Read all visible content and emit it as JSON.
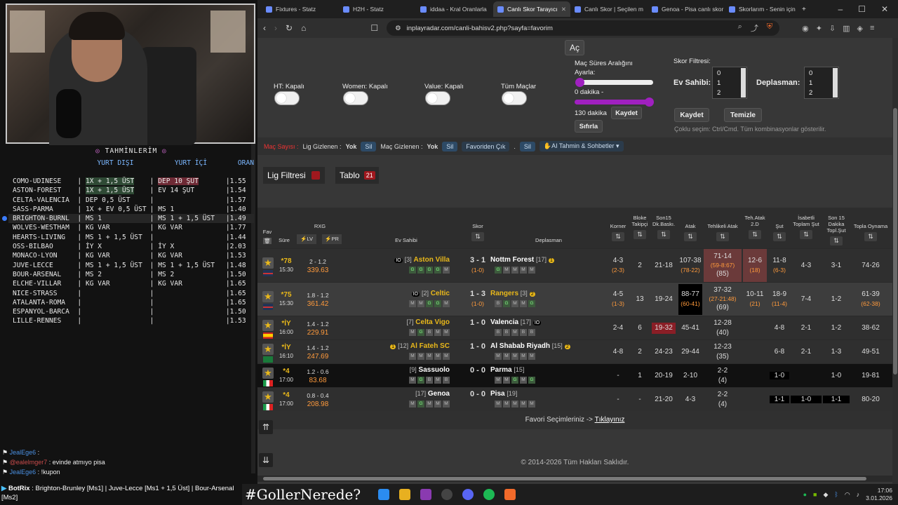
{
  "stream": {
    "tips_title": "TAHMİNLERİM",
    "col_away": "YURT DIŞI",
    "col_home": "YURT İÇİ",
    "col_odds": "ORAN",
    "tips": [
      {
        "match": "COMO-UDINESE",
        "a": "1X + 1,5 ÜST",
        "b": "DEP 10 ŞUT",
        "odd": "1.55",
        "hl": "red"
      },
      {
        "match": "ASTON-FOREST",
        "a": "1X + 1,5 ÜST",
        "b": "EV 14 ŞUT",
        "odd": "1.54",
        "hl": "grn"
      },
      {
        "match": "CELTA-VALENCIA",
        "a": "DEP 0,5 ÜST",
        "b": "",
        "odd": "1.57",
        "hl": ""
      },
      {
        "match": "SASS-PARMA",
        "a": "1X + EV 0,5 ÜST",
        "b": "MS 1",
        "odd": "1.40",
        "hl": ""
      },
      {
        "match": "BRIGHTON-BURNL",
        "a": "MS 1",
        "b": "MS 1 + 1,5 ÜST",
        "odd": "1.49",
        "hl": "sel"
      },
      {
        "match": "WOLVES-WESTHAM",
        "a": "KG VAR",
        "b": "KG VAR",
        "odd": "1.77",
        "hl": ""
      },
      {
        "match": "HEARTS-LIVING",
        "a": "MS 1 + 1,5 ÜST",
        "b": "",
        "odd": "1.44",
        "hl": ""
      },
      {
        "match": "OSS-BILBAO",
        "a": "İY X",
        "b": "İY X",
        "odd": "2.03",
        "hl": ""
      },
      {
        "match": "MONACO-LYON",
        "a": "KG VAR",
        "b": "KG VAR",
        "odd": "1.53",
        "hl": ""
      },
      {
        "match": "JUVE-LECCE",
        "a": "MS 1 + 1,5 ÜST",
        "b": "MS 1 + 1,5 ÜST",
        "odd": "1.48",
        "hl": ""
      },
      {
        "match": "BOUR-ARSENAL",
        "a": "MS 2",
        "b": "MS 2",
        "odd": "1.50",
        "hl": ""
      },
      {
        "match": "ELCHE-VILLAR",
        "a": "KG VAR",
        "b": "KG VAR",
        "odd": "1.65",
        "hl": ""
      },
      {
        "match": "NICE-STRASS",
        "a": "",
        "b": "",
        "odd": "1.65",
        "hl": ""
      },
      {
        "match": "ATALANTA-ROMA",
        "a": "",
        "b": "",
        "odd": "1.65",
        "hl": ""
      },
      {
        "match": "ESPANYOL-BARCA",
        "a": "",
        "b": "",
        "odd": "1.50",
        "hl": ""
      },
      {
        "match": "LILLE-RENNES",
        "a": "",
        "b": "",
        "odd": "1.53",
        "hl": ""
      }
    ],
    "chat": [
      {
        "user": "JealEge6",
        "text": ""
      },
      {
        "user": "@ealelmger7",
        "text": "evinde atmıyo pisa"
      },
      {
        "user": "JealEge6",
        "text": "!kupon"
      }
    ],
    "bot_user": "BotRix",
    "bot_text": ": Brighton-Brunley [Ms1] | Juve-Lecce [Ms1 + 1,5 Üst] | Bour-Arsenal [Ms2]",
    "hashtag": "#GollerNerede?"
  },
  "browser": {
    "tabs": [
      "Fixtures - Statz",
      "H2H - Statz",
      "iddaa - Kral Oranlarla",
      "Canlı Skor Tarayıcı",
      "Canlı Skor | Seçilen m",
      "Genoa - Pisa canlı skor",
      "Skorlarım - Senin için"
    ],
    "url": "inplayradar.com/canli-bahisv2.php?sayfa=favorim"
  },
  "filters": {
    "open_btn": "Aç",
    "ht": "HT: Kapalı",
    "women": "Women: Kapalı",
    "value": "Value: Kapalı",
    "all": "Tüm Maçlar",
    "range_title": "Maç Süres Aralığını Ayarla:",
    "range_min": "0 dakika -",
    "range_max": "130 dakika",
    "save": "Kaydet",
    "reset": "Sıfırla",
    "score_title": "Skor Filtresi:",
    "home_label": "Ev Sahibi:",
    "away_label": "Deplasman:",
    "score_opts": [
      "0",
      "1",
      "2"
    ],
    "save2": "Kaydet",
    "clear": "Temizle",
    "hint": "Çoklu seçim: Ctrl/Cmd. Tüm kombinasyonlar gösterilir."
  },
  "chips": {
    "count_label": "Maç Sayısı :",
    "lig_hidden": "Lig Gizlenen :",
    "yok": "Yok",
    "sil": "Sil",
    "mac_hidden": "Maç Gizlenen :",
    "unfav": "Favoriden Çık",
    "ai": "AI Tahmin & Sohbetler"
  },
  "lig_filter": "Lig Filtresi",
  "tablo": "Tablo",
  "tablo_count": "21",
  "headers": {
    "fav": "Fav",
    "sure": "Süre",
    "rxg": "RXG",
    "lv": "LV",
    "pr": "PR",
    "home": "Ev Sahibi",
    "score": "Skor",
    "away": "Deplasman",
    "korner": "Korner",
    "bloke": "Bloke Takipçi",
    "son15": "Son15 Dk.Baskı.",
    "atak": "Atak",
    "tatak": "Tehlikeli Atak",
    "teh2d": "Teh.Atak 2.D",
    "sut": "Şut",
    "isabet": "İsabetli Toplam Şut",
    "son15sut": "Son 15 Dakika Topl.Şut",
    "topla": "Topla Oynama"
  },
  "matches": [
    {
      "min": "78",
      "time": "15:30",
      "xg": "2 - 1.2",
      "rx": "339.63",
      "home": "Aston Villa",
      "hrank": "[3]",
      "hbadge": "IO",
      "score": "3 - 1",
      "ht": "(1-0)",
      "away": "Nottm Forest",
      "arank": "[17]",
      "abadge": "1",
      "korner": "4-3",
      "ksub": "(2-3)",
      "bloke": "2",
      "son15": "21-18",
      "atak": "107-38",
      "asub": "(78-22)",
      "tatak": "71-14",
      "tsub": "(59-8:67)",
      "tsub2": "(85)",
      "t2d": "12-6",
      "t2dsub": "(18)",
      "sut": "11-8",
      "ssub": "(6-3)",
      "isabet": "4-3",
      "s15": "3-1",
      "topla": "74-26",
      "tsub3": ""
    },
    {
      "min": "75",
      "time": "15:30",
      "xg": "1.8 - 1.2",
      "rx": "361.42",
      "home": "Celtic",
      "hrank": "[2]",
      "hbadge": "IO",
      "score": "1 - 3",
      "ht": "(1-0)",
      "away": "Rangers",
      "arank": "[3]",
      "abadge": "2",
      "korner": "4-5",
      "ksub": "(1-3)",
      "bloke": "13",
      "son15": "19-24",
      "atak": "88-77",
      "asub": "(60-41)",
      "tatak": "37-32",
      "tsub": "(27-21:48)",
      "tsub2": "(69)",
      "t2d": "10-11",
      "t2dsub": "(21)",
      "sut": "18-9",
      "ssub": "(11-4)",
      "isabet": "7-4",
      "s15": "1-2",
      "topla": "61-39",
      "tsub3": "(62-38)"
    },
    {
      "min": "İY",
      "time": "16:00",
      "xg": "1.4 - 1.2",
      "rx": "229.91",
      "home": "Celta Vigo",
      "hrank": "[7]",
      "hbadge": "",
      "score": "1 - 0",
      "ht": "",
      "away": "Valencia",
      "arank": "[17]",
      "abadge": "IO",
      "korner": "2-4",
      "ksub": "",
      "bloke": "6",
      "son15": "19-32",
      "atak": "45-41",
      "asub": "",
      "tatak": "12-28",
      "tsub": "",
      "tsub2": "(40)",
      "t2d": "",
      "t2dsub": "",
      "sut": "4-8",
      "ssub": "",
      "isabet": "2-1",
      "s15": "1-2",
      "topla": "38-62",
      "tsub3": ""
    },
    {
      "min": "İY",
      "time": "16:10",
      "xg": "1.4 - 1.2",
      "rx": "247.69",
      "home": "Al Fateh SC",
      "hrank": "[12]",
      "hbadge": "1",
      "score": "1 - 0",
      "ht": "",
      "away": "Al Shabab Riyadh",
      "arank": "[15]",
      "abadge": "2",
      "korner": "4-8",
      "ksub": "",
      "bloke": "2",
      "son15": "24-23",
      "atak": "29-44",
      "asub": "",
      "tatak": "12-23",
      "tsub": "",
      "tsub2": "(35)",
      "t2d": "",
      "t2dsub": "",
      "sut": "6-8",
      "ssub": "",
      "isabet": "2-1",
      "s15": "1-3",
      "topla": "49-51",
      "tsub3": ""
    },
    {
      "min": "4",
      "time": "17:00",
      "xg": "1.2 - 0.6",
      "rx": "83.68",
      "home": "Sassuolo",
      "hrank": "[9]",
      "hbadge": "",
      "score": "0 - 0",
      "ht": "",
      "away": "Parma",
      "arank": "[15]",
      "abadge": "",
      "korner": "-",
      "ksub": "",
      "bloke": "1",
      "son15": "20-19",
      "atak": "2-10",
      "asub": "",
      "tatak": "2-2",
      "tsub": "",
      "tsub2": "(4)",
      "t2d": "",
      "t2dsub": "",
      "sut": "1-0",
      "ssub": "",
      "isabet": "",
      "s15": "1-0",
      "topla": "19-81",
      "tsub3": ""
    },
    {
      "min": "4",
      "time": "17:00",
      "xg": "0.8 - 0.4",
      "rx": "208.98",
      "home": "Genoa",
      "hrank": "[17]",
      "hbadge": "",
      "score": "0 - 0",
      "ht": "",
      "away": "Pisa",
      "arank": "[19]",
      "abadge": "",
      "korner": "-",
      "ksub": "",
      "bloke": "-",
      "son15": "21-20",
      "atak": "4-3",
      "asub": "",
      "tatak": "2-2",
      "tsub": "",
      "tsub2": "(4)",
      "t2d": "",
      "t2dsub": "",
      "sut": "1-1",
      "ssub": "",
      "isabet": "1-0",
      "s15": "1-1",
      "topla": "80-20",
      "tsub3": ""
    }
  ],
  "fav_footer": "Favori Seçimleriniz ->",
  "fav_link": "Tıklayınız",
  "copyright": "© 2014-2026 Tüm Hakları Saklıdır.",
  "clock": {
    "time": "17:06",
    "date": "3.01.2026"
  },
  "colors": {
    "accent": "#a020c0",
    "gold": "#e9b81a",
    "red": "#a0181e"
  }
}
